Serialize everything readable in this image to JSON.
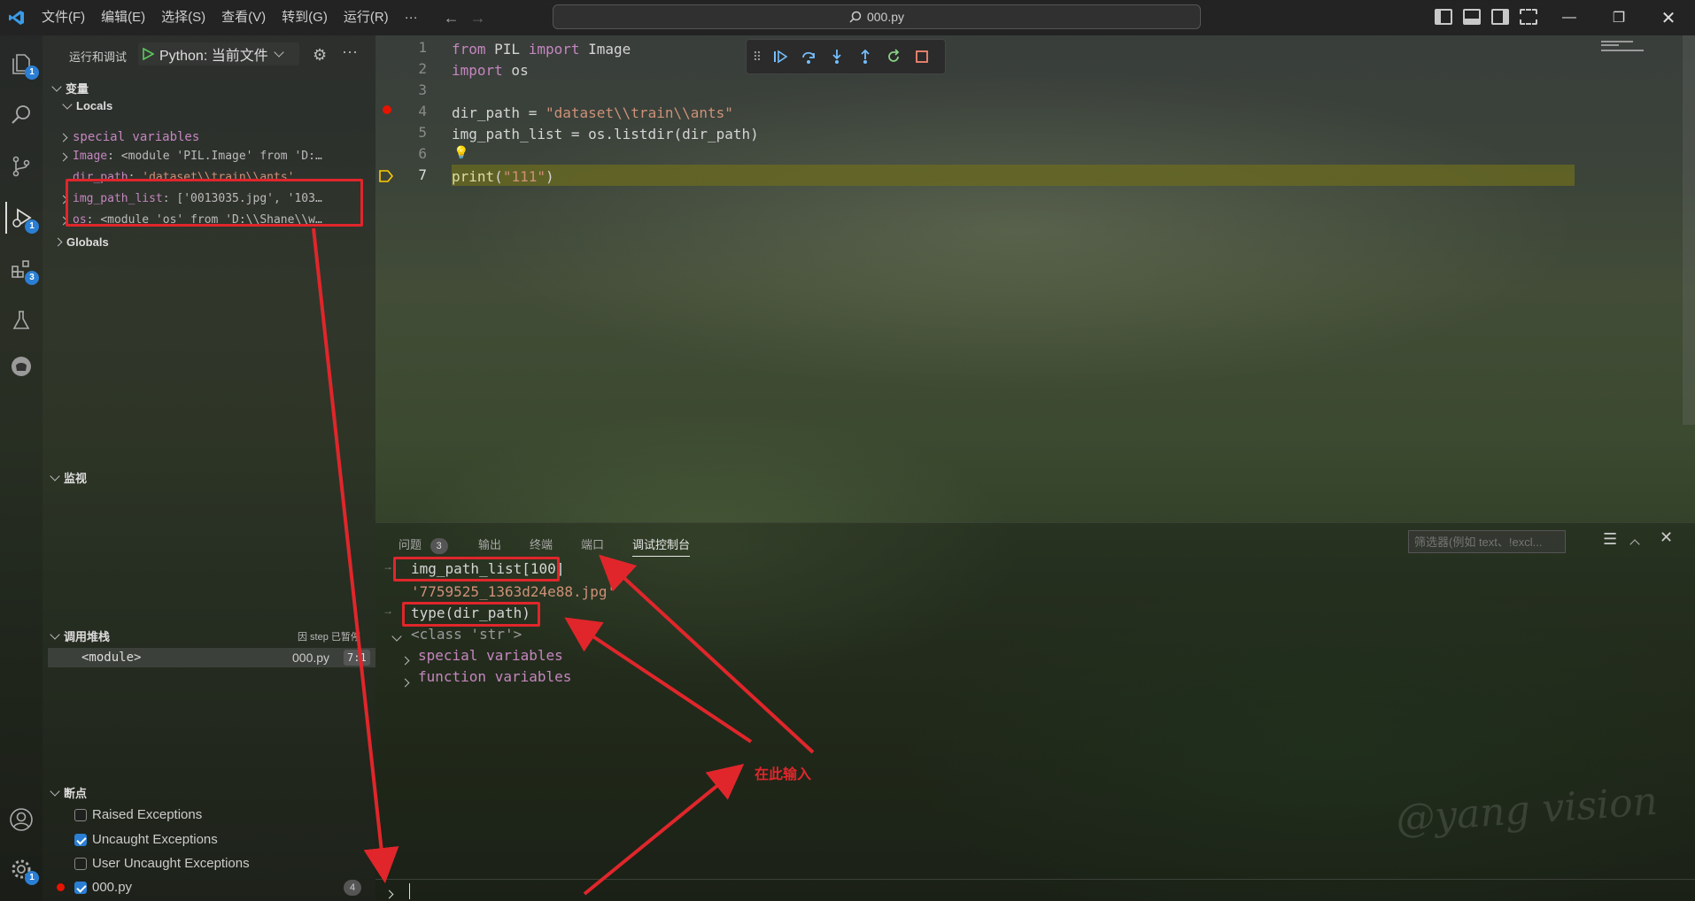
{
  "titlebar": {
    "menus": [
      "文件(F)",
      "编辑(E)",
      "选择(S)",
      "查看(V)",
      "转到(G)",
      "运行(R)",
      "···"
    ],
    "search_text": "000.py"
  },
  "activity": {
    "explorer_badge": "1",
    "debug_badge": "1",
    "extensions_badge": "3",
    "settings_badge": "1"
  },
  "sidebar": {
    "run_debug_label": "运行和调试",
    "config_name": "Python: 当前文件",
    "variables_header": "变量",
    "locals_header": "Locals",
    "variables": [
      {
        "name": "special variables",
        "value": ""
      },
      {
        "name": "Image",
        "value": "<module 'PIL.Image' from 'D:…"
      },
      {
        "name": "dir_path",
        "value": "'dataset\\\\train\\\\ants'"
      },
      {
        "name": "img_path_list",
        "value": "['0013035.jpg', '103…"
      },
      {
        "name": "os",
        "value": "<module 'os' from 'D:\\\\Shane\\\\w…"
      }
    ],
    "globals_header": "Globals",
    "watch_header": "监视",
    "callstack_header": "调用堆栈",
    "callstack_status": "因 step 已暂停",
    "callstack_frame": "<module>",
    "callstack_file": "000.py",
    "callstack_pos": "7:1",
    "breakpoints_header": "断点",
    "breakpoints": [
      {
        "label": "Raised Exceptions",
        "checked": false
      },
      {
        "label": "Uncaught Exceptions",
        "checked": true
      },
      {
        "label": "User Uncaught Exceptions",
        "checked": false
      },
      {
        "label": "000.py",
        "checked": true,
        "count": "4"
      }
    ]
  },
  "editor": {
    "lines": [
      {
        "n": "1",
        "tokens": [
          [
            "kw",
            "from"
          ],
          [
            "plain",
            " PIL "
          ],
          [
            "kw",
            "import"
          ],
          [
            "plain",
            " Image"
          ]
        ]
      },
      {
        "n": "2",
        "tokens": [
          [
            "kw",
            "import"
          ],
          [
            "plain",
            " os"
          ]
        ]
      },
      {
        "n": "3",
        "tokens": []
      },
      {
        "n": "4",
        "tokens": [
          [
            "plain",
            "dir_path = "
          ],
          [
            "str",
            "\"dataset\\\\train\\\\ants\""
          ]
        ]
      },
      {
        "n": "5",
        "tokens": [
          [
            "plain",
            "img_path_list = os.listdir(dir_path)"
          ]
        ]
      },
      {
        "n": "6",
        "tokens": []
      },
      {
        "n": "7",
        "tokens": [
          [
            "fn",
            "print"
          ],
          [
            "plain",
            "("
          ],
          [
            "str",
            "\"111\""
          ],
          [
            "plain",
            ")"
          ]
        ]
      }
    ]
  },
  "panel": {
    "tabs": [
      "问题",
      "输出",
      "终端",
      "端口",
      "调试控制台"
    ],
    "problems_count": "3",
    "filter_placeholder": "筛选器(例如 text、!excl...",
    "console": {
      "input1": "img_path_list[100]",
      "output1": "'7759525_1363d24e88.jpg'",
      "input2": "type(dir_path)",
      "output2": "<class 'str'>",
      "child1": "special variables",
      "child2": "function variables"
    }
  },
  "annotation": {
    "text": "在此输入"
  },
  "watermark": "@yang vision",
  "colors": {
    "accent": "#2a7fd4",
    "annotation_red": "#e0262b",
    "current_line": "#6b6b1f"
  }
}
